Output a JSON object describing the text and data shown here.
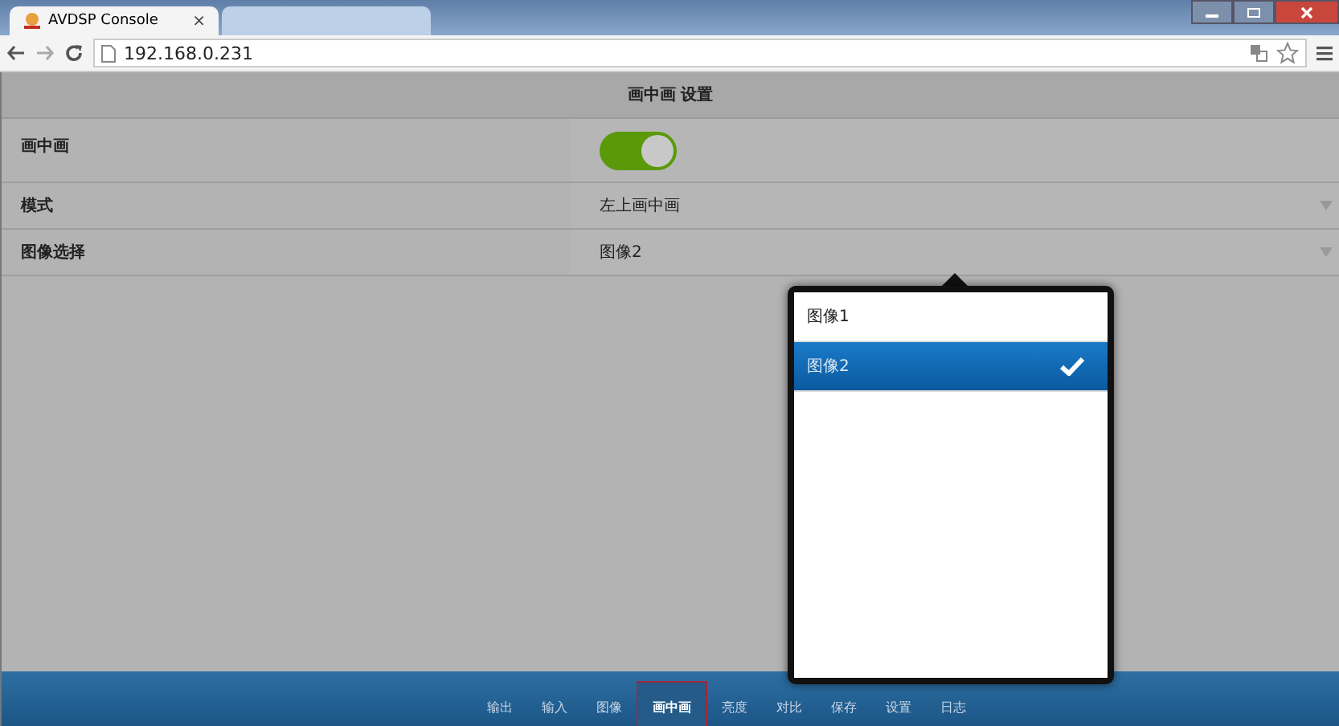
{
  "browser": {
    "tabs": [
      {
        "title": "AVDSP Console",
        "close": "×",
        "selected": true
      },
      {
        "selected": false
      }
    ],
    "address": "192.168.0.231"
  },
  "page": {
    "title": "画中画 设置",
    "settings": [
      {
        "kind": "toggle",
        "label": "画中画",
        "on": true
      },
      {
        "kind": "select",
        "label": "模式",
        "value": "左上画中画"
      },
      {
        "kind": "select",
        "label": "图像选择",
        "value": "图像2"
      }
    ]
  },
  "popup": {
    "options": [
      {
        "label": "图像1",
        "selected": false
      },
      {
        "label": "图像2",
        "selected": true
      }
    ]
  },
  "nav": [
    {
      "label": "输出",
      "selected": false
    },
    {
      "label": "输入",
      "selected": false
    },
    {
      "label": "图像",
      "selected": false
    },
    {
      "label": "画中画",
      "selected": true
    },
    {
      "label": "亮度",
      "selected": false
    },
    {
      "label": "对比",
      "selected": false
    },
    {
      "label": "保存",
      "selected": false
    },
    {
      "label": "设置",
      "selected": false
    },
    {
      "label": "日志",
      "selected": false
    }
  ]
}
